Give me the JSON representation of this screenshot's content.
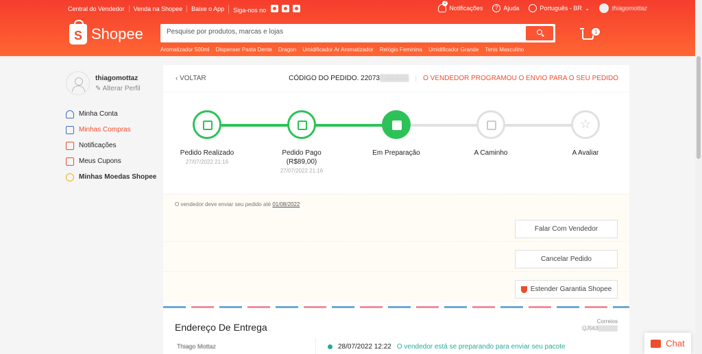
{
  "header": {
    "links": [
      "Central do Vendedor",
      "Venda na Shopee",
      "Baixe o App",
      "Siga-nos no"
    ],
    "social_icons": [
      "instagram-icon",
      "twitter-icon",
      "tiktok-icon"
    ],
    "notifications_label": "Notificações",
    "notifications_count": "2",
    "help_label": "Ajuda",
    "language_label": "Português - BR",
    "username": "thiagomottaz",
    "logo_text": "Shopee",
    "search_placeholder": "Pesquise por produtos, marcas e lojas",
    "suggestions": [
      "Aromatizador 500ml",
      "Dispenser Pasta Dente",
      "Dragon",
      "Umidificador Ar Aromatizador",
      "Relógio Feminina",
      "Umidificador Grande",
      "Tenis Masculino"
    ],
    "cart_count": "1",
    "brand_color": "#ee4d2d"
  },
  "sidebar": {
    "username": "thiagomottaz",
    "edit_profile": "Alterar Perfil",
    "menu": [
      {
        "label": "Minha Conta",
        "icon": "user-icon",
        "active": false
      },
      {
        "label": "Minhas Compras",
        "icon": "clipboard-icon",
        "active": true
      },
      {
        "label": "Notificações",
        "icon": "bell-icon",
        "active": false
      },
      {
        "label": "Meus Cupons",
        "icon": "coupon-icon",
        "active": false
      },
      {
        "label": "Minhas Moedas Shopee",
        "icon": "coin-icon",
        "active": false
      }
    ]
  },
  "order": {
    "back_label": "VOLTAR",
    "code_label": "CÓDIGO DO PEDIDO. 22073",
    "status": "O VENDEDOR PROGRAMOU O ENVIO PARA O SEU PEDIDO",
    "steps": [
      {
        "label": "Pedido Realizado",
        "sub": "",
        "date": "27/07/2022 21:16",
        "icon": "receipt-icon",
        "state": "done"
      },
      {
        "label": "Pedido Pago",
        "sub": "(R$89,00)",
        "date": "27/07/2022 21:16",
        "icon": "money-icon",
        "state": "done"
      },
      {
        "label": "Em Preparação",
        "sub": "",
        "date": "",
        "icon": "truck-icon",
        "state": "current"
      },
      {
        "label": "A Caminho",
        "sub": "",
        "date": "",
        "icon": "inbox-icon",
        "state": "todo"
      },
      {
        "label": "A Avaliar",
        "sub": "",
        "date": "",
        "icon": "star-icon",
        "state": "todo"
      }
    ],
    "ship_notice": "O vendedor deve enviar seu pedido até",
    "ship_date": "01/08/2022",
    "buttons": [
      "Falar Com Vendedor",
      "Cancelar Pedido",
      "Estender Garantia Shopee"
    ],
    "delivery_title": "Endereço De Entrega",
    "carrier": "Correios",
    "tracking_code": "QJ563",
    "recipient": "Thiago Mottaz",
    "tracking_time": "28/07/2022 12:22",
    "tracking_message": "O vendedor está se preparando para enviar seu pacote",
    "success_color": "#2dc258",
    "teal_color": "#26aa99"
  },
  "chat_label": "Chat"
}
